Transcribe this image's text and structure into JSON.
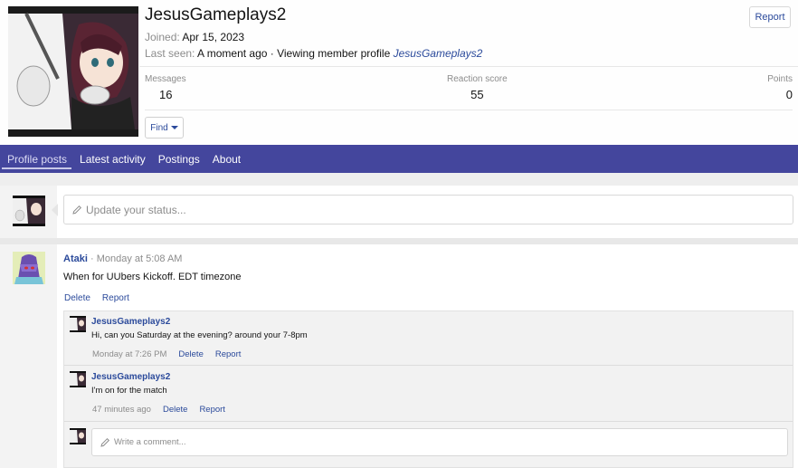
{
  "profile": {
    "username": "JesusGameplays2",
    "joined_label": "Joined:",
    "joined_value": "Apr 15, 2023",
    "lastseen_label": "Last seen:",
    "lastseen_value": "A moment ago · Viewing member profile",
    "lastseen_link": "JesusGameplays2",
    "report_label": "Report",
    "find_label": "Find"
  },
  "stats": {
    "messages_label": "Messages",
    "messages_value": "16",
    "reaction_label": "Reaction score",
    "reaction_value": "55",
    "points_label": "Points",
    "points_value": "0"
  },
  "nav": {
    "tabs": [
      {
        "label": "Profile posts"
      },
      {
        "label": "Latest activity"
      },
      {
        "label": "Postings"
      },
      {
        "label": "About"
      }
    ]
  },
  "status": {
    "placeholder": "Update your status..."
  },
  "post": {
    "author": "Ataki",
    "time": "· Monday at 5:08 AM",
    "body": "When for UUbers Kickoff. EDT timezone",
    "delete_label": "Delete",
    "report_label": "Report"
  },
  "comments": [
    {
      "author": "JesusGameplays2",
      "text": "Hi, can you Saturday at the evening? around your 7-8pm",
      "time": "Monday at 7:26 PM",
      "delete_label": "Delete",
      "report_label": "Report"
    },
    {
      "author": "JesusGameplays2",
      "text": "I'm on for the match",
      "time": "47 minutes ago",
      "delete_label": "Delete",
      "report_label": "Report"
    }
  ],
  "comment_box": {
    "placeholder": "Write a comment..."
  },
  "colors": {
    "nav_bg": "#44469d",
    "link": "#2b4a9b"
  }
}
